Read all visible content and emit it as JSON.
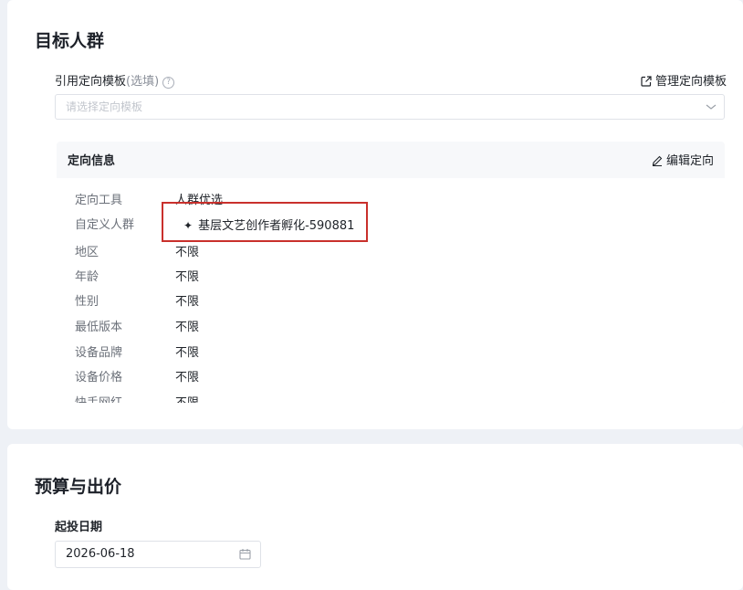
{
  "target_section": {
    "title": "目标人群",
    "template_label": "引用定向模板",
    "template_optional": "(选填)",
    "help_icon": "?",
    "manage_link": "管理定向模板",
    "select_placeholder": "请选择定向模板",
    "panel": {
      "title": "定向信息",
      "edit_link": "编辑定向",
      "rows": [
        {
          "key": "定向工具",
          "value": "人群优选"
        },
        {
          "key": "自定义人群",
          "value": "基层文艺创作者孵化-590881"
        },
        {
          "key": "地区",
          "value": "不限"
        },
        {
          "key": "年龄",
          "value": "不限"
        },
        {
          "key": "性别",
          "value": "不限"
        },
        {
          "key": "最低版本",
          "value": "不限"
        },
        {
          "key": "设备品牌",
          "value": "不限"
        },
        {
          "key": "设备价格",
          "value": "不限"
        },
        {
          "key": "快手网红",
          "value": "不限"
        }
      ]
    }
  },
  "budget_section": {
    "title": "预算与出价",
    "start_date_label": "起投日期",
    "start_date_value": "2026-06-18"
  },
  "icons": {
    "external_link": "external-link-icon",
    "chevron": "chevron-down-icon",
    "edit": "pencil-icon",
    "tag": "sparkle-icon",
    "calendar": "calendar-icon"
  },
  "colors": {
    "highlight_border": "#c9302c",
    "panel_bg": "#f7f8fa",
    "page_bg": "#eef1f6"
  }
}
